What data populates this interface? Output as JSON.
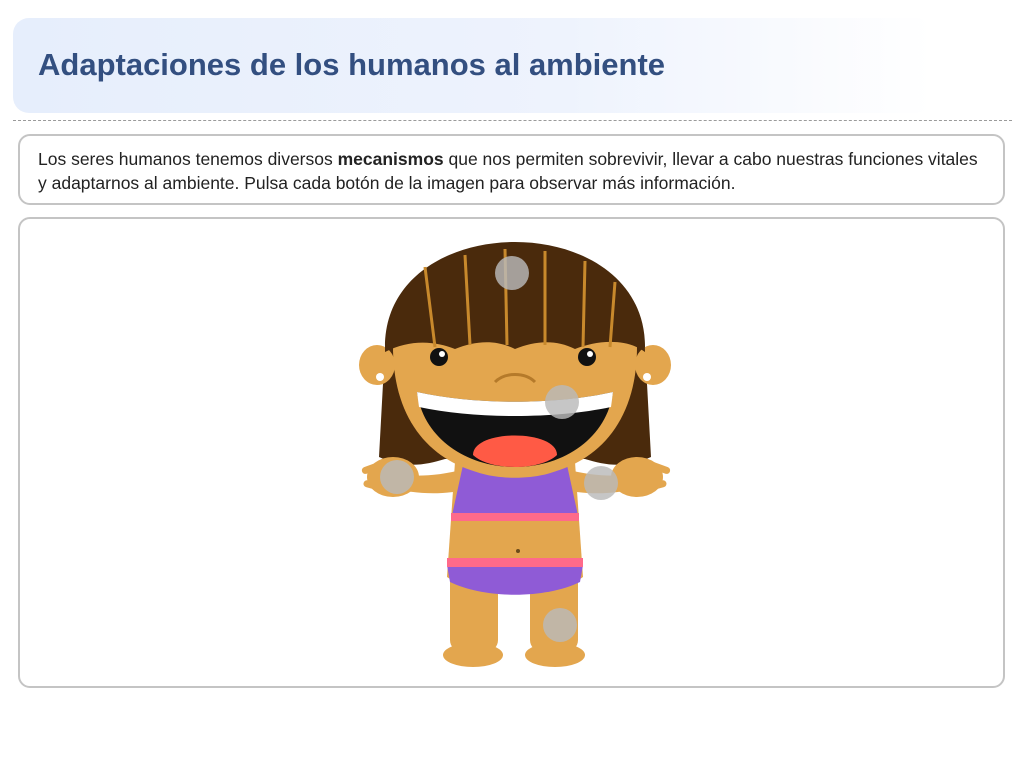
{
  "header": {
    "title": "Adaptaciones de los humanos al ambiente"
  },
  "instructions": {
    "text_before": "Los seres humanos tenemos diversos ",
    "text_bold": "mecanismos",
    "text_after": " que nos permiten sobrevivir, llevar a cabo nuestras funciones vitales y adaptarnos al ambiente. Pulsa cada botón de la imagen para observar más información."
  },
  "figure": {
    "description_icon": "girl-character-illustration",
    "hotspots": [
      "head",
      "mouth",
      "left-hand",
      "right-hand",
      "leg"
    ]
  },
  "colors": {
    "title": "#334f80",
    "skin": "#e3a64e",
    "hair": "#4a2a0c",
    "swimsuit": "#8f5bd6",
    "trim": "#ff6a8a",
    "hotspot": "#bdbdbd"
  }
}
